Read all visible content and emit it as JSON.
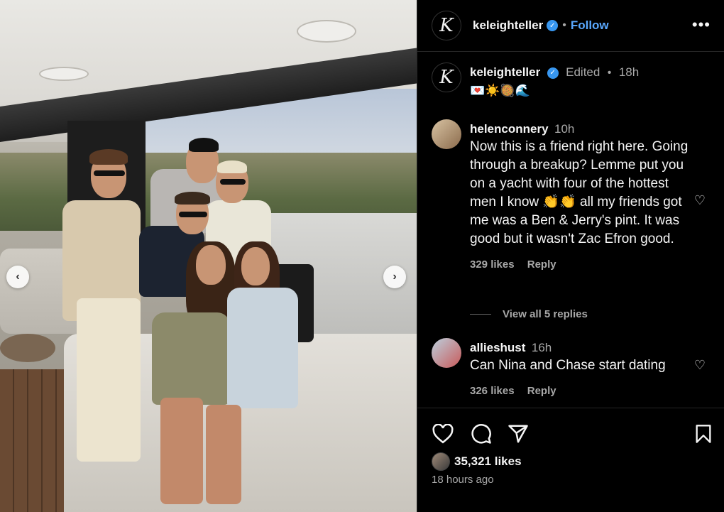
{
  "post": {
    "photo_alt": "Group of friends posing on a yacht deck"
  },
  "header": {
    "avatar_letter": "K",
    "username": "keleighteller",
    "separator": "•",
    "follow_label": "Follow",
    "more_label": "•••"
  },
  "caption": {
    "avatar_letter": "K",
    "username": "keleighteller",
    "edited": "Edited",
    "separator": "•",
    "time": "18h",
    "emojis": "💌☀️🥘🌊"
  },
  "comments": [
    {
      "username": "helenconnery",
      "time": "10h",
      "text": "Now this is a friend right here. Going through a breakup? Lemme put you on a yacht with four of the hottest men I know 👏👏 all my friends got me was a Ben & Jerry's pint. It was good but it wasn't Zac Efron good.",
      "likes": "329 likes",
      "reply": "Reply"
    },
    {
      "username": "allieshust",
      "time": "16h",
      "text": "Can Nina and Chase start dating",
      "likes": "326 likes",
      "reply": "Reply"
    }
  ],
  "view_replies": "View all 5 replies",
  "actions": {
    "like_icon": "heart-outline-icon",
    "comment_icon": "comment-bubble-icon",
    "share_icon": "paper-plane-icon",
    "save_icon": "bookmark-icon",
    "likes_count": "35,321 likes",
    "time_ago": "18 hours ago"
  },
  "colors": {
    "background": "#000000",
    "text": "#f5f5f5",
    "muted": "#a8a8a8",
    "link": "#5aa9ff",
    "verified": "#3897f0"
  }
}
